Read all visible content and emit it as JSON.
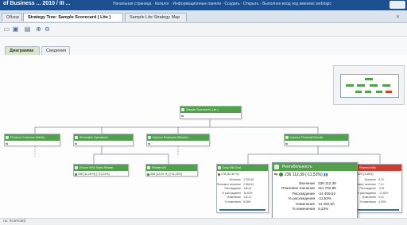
{
  "topbar": {
    "title": "of Business ...      2010 / III ...",
    "links": "Начальная страница  ·  Каталог  ·  Информационные панели  ·  Создать  ·  Открыть  ·  Выполнен вход под именем: weblogic"
  },
  "tabs": [
    {
      "label": "Обзор"
    },
    {
      "label": "Strategy Tree: Sample Scorecard ( Lite )"
    },
    {
      "label": "Sample Lite Strategy Map"
    }
  ],
  "subtabs": [
    {
      "label": "Диаграмма"
    },
    {
      "label": "Сведения"
    }
  ],
  "status": "ль: Scorecard",
  "root": {
    "title": "Sample Scorecard ( Lite )"
  },
  "level2": [
    {
      "title": "Enhance Customer Satisfa..."
    },
    {
      "title": "Streamline Operations"
    },
    {
      "title": "Improve Employee Effective..."
    },
    {
      "title": "Improve Financial Results"
    }
  ],
  "level3": [
    {
      "title": "Ensure 90% Sales Rebate",
      "value": "236 (11,28 %) (+11,23%)"
    },
    {
      "title": "Rebate 4/5",
      "value": "306 (12,29 %) (+11,23%)"
    },
    {
      "title": "Drop Mkt Cost",
      "value": "178 (52,39 %)"
    },
    {
      "title": "Revenue Mix",
      "value": "524 (4,48%)"
    }
  ],
  "widgets": {
    "left": [
      {
        "k": "Значение",
        "v": "2 905,36"
      },
      {
        "k": "Плановое значение",
        "v": "2 864,54"
      },
      {
        "k": "Расхождение",
        "v": "146,40"
      },
      {
        "k": "% расхождения",
        "v": "16,63%"
      },
      {
        "k": "Изменение",
        "v": "142,10"
      },
      {
        "k": "% изменения",
        "v": "8,55%"
      }
    ],
    "right": [
      {
        "k": "Значение",
        "v": "6,23"
      },
      {
        "k": "Плановое значение",
        "v": "7,14"
      },
      {
        "k": "Расхождение",
        "v": "-0,91"
      },
      {
        "k": "% расхождения",
        "v": "-12,84%"
      },
      {
        "k": "Изменение",
        "v": "0,44"
      },
      {
        "k": "% изменения",
        "v": "4,25%"
      }
    ]
  },
  "popup": {
    "title": "Рентабельность",
    "value": "236 112,39 (-11,53%)",
    "rows": [
      {
        "k": "Значение",
        "v": "236 112,39"
      },
      {
        "k": "Плановое значение",
        "v": "211 702,86"
      },
      {
        "k": "Расхождение",
        "v": "-24 409,52"
      },
      {
        "k": "% расхождения",
        "v": "-11,53%"
      },
      {
        "k": "Изменение",
        "v": "14 200,50"
      },
      {
        "k": "% изменения",
        "v": "6,43%"
      }
    ]
  },
  "colors": {
    "accent": "#4fa24a",
    "alert": "#d23b2e",
    "topbar": "#1b4f8f"
  }
}
